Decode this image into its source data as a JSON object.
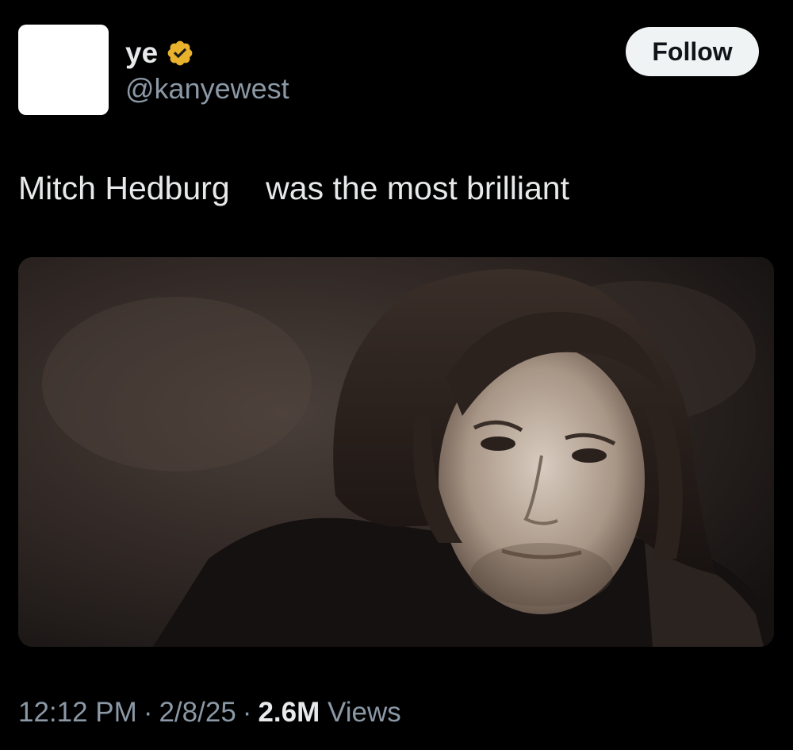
{
  "author": {
    "display_name": "ye",
    "handle": "@kanyewest",
    "verified_badge_icon": "verified-badge-icon",
    "verified_color": "#e8b22c"
  },
  "actions": {
    "follow_label": "Follow"
  },
  "tweet": {
    "text": "Mitch Hedburg    was the most brilliant",
    "media_description_icon": "photo-portrait"
  },
  "meta": {
    "time": "12:12 PM",
    "separator": "·",
    "date": "2/8/25",
    "views_count": "2.6M",
    "views_label": "Views"
  },
  "colors": {
    "background": "#000000",
    "text_primary": "#e7e9ea",
    "text_secondary": "#8b98a5",
    "follow_bg": "#eff3f4"
  }
}
